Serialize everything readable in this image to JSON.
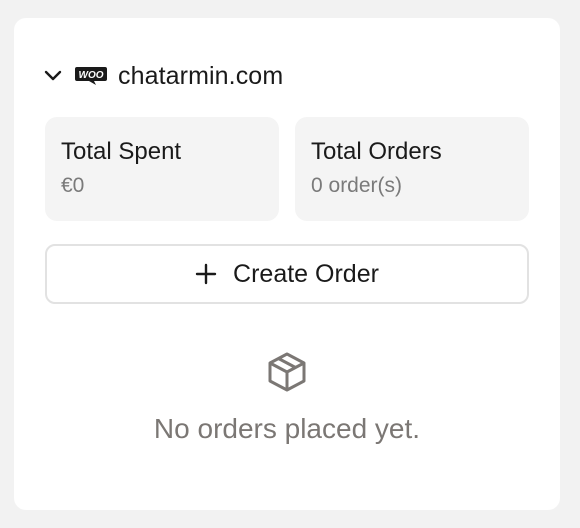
{
  "store": {
    "name": "chatarmin.com",
    "logo_icon": "woocommerce-icon",
    "collapse_icon": "chevron-down-icon"
  },
  "stats": [
    {
      "label": "Total Spent",
      "value": "€0"
    },
    {
      "label": "Total Orders",
      "value": "0 order(s)"
    }
  ],
  "actions": {
    "create_order_label": "Create Order",
    "create_order_icon": "plus-icon"
  },
  "empty_state": {
    "icon": "box-icon",
    "message": "No orders placed yet."
  },
  "colors": {
    "background": "#f2f2f2",
    "card": "#ffffff",
    "stat_bg": "#f4f4f4",
    "muted_text": "#7a7a7a",
    "primary_text": "#1a1a1a"
  }
}
